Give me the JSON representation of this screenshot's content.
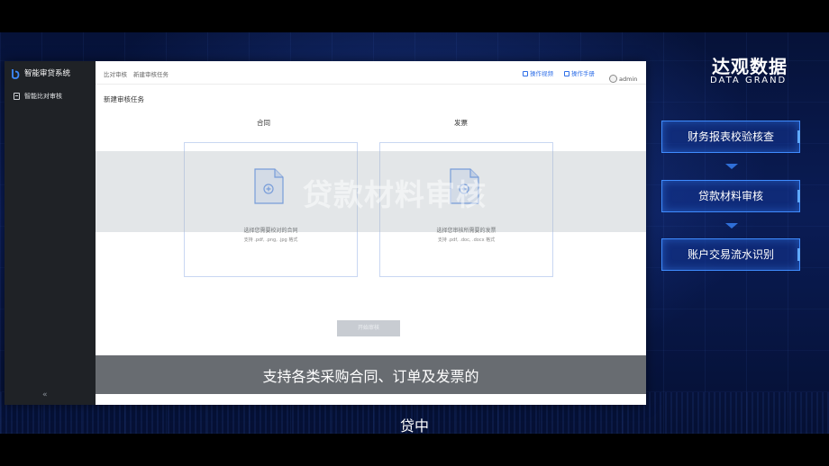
{
  "app": {
    "title": "智能审贷系统",
    "menu_item": "智能比对审核",
    "collapse_glyph": "«"
  },
  "header": {
    "breadcrumb": [
      "比对审核",
      "新建审核任务"
    ],
    "video_link": "操作视频",
    "manual_link": "操作手册",
    "user": "admin"
  },
  "page": {
    "title": "新建审核任务",
    "sections": [
      {
        "title": "合同",
        "prompt": "选择您需要校对的合同",
        "hint": "支持 .pdf, .png, .jpg 格式"
      },
      {
        "title": "发票",
        "prompt": "选择您审核所需要的发票",
        "hint": "支持 .pdf, .doc, .docx 格式"
      }
    ],
    "start_button": "开始审核"
  },
  "overlay": {
    "caption": "贷款材料审核",
    "subtitle_line1": "支持各类采购合同、订单及发票的",
    "subtitle_line2": "贷中"
  },
  "brand": {
    "name_cn": "达观数据",
    "name_en": "DATA GRAND"
  },
  "flow": [
    "财务报表校验核查",
    "贷款材料审核",
    "账户交易流水识别"
  ],
  "colors": {
    "accent": "#2f6fe8",
    "sidebar": "#1f2226",
    "flow_border": "#3f8cff"
  }
}
